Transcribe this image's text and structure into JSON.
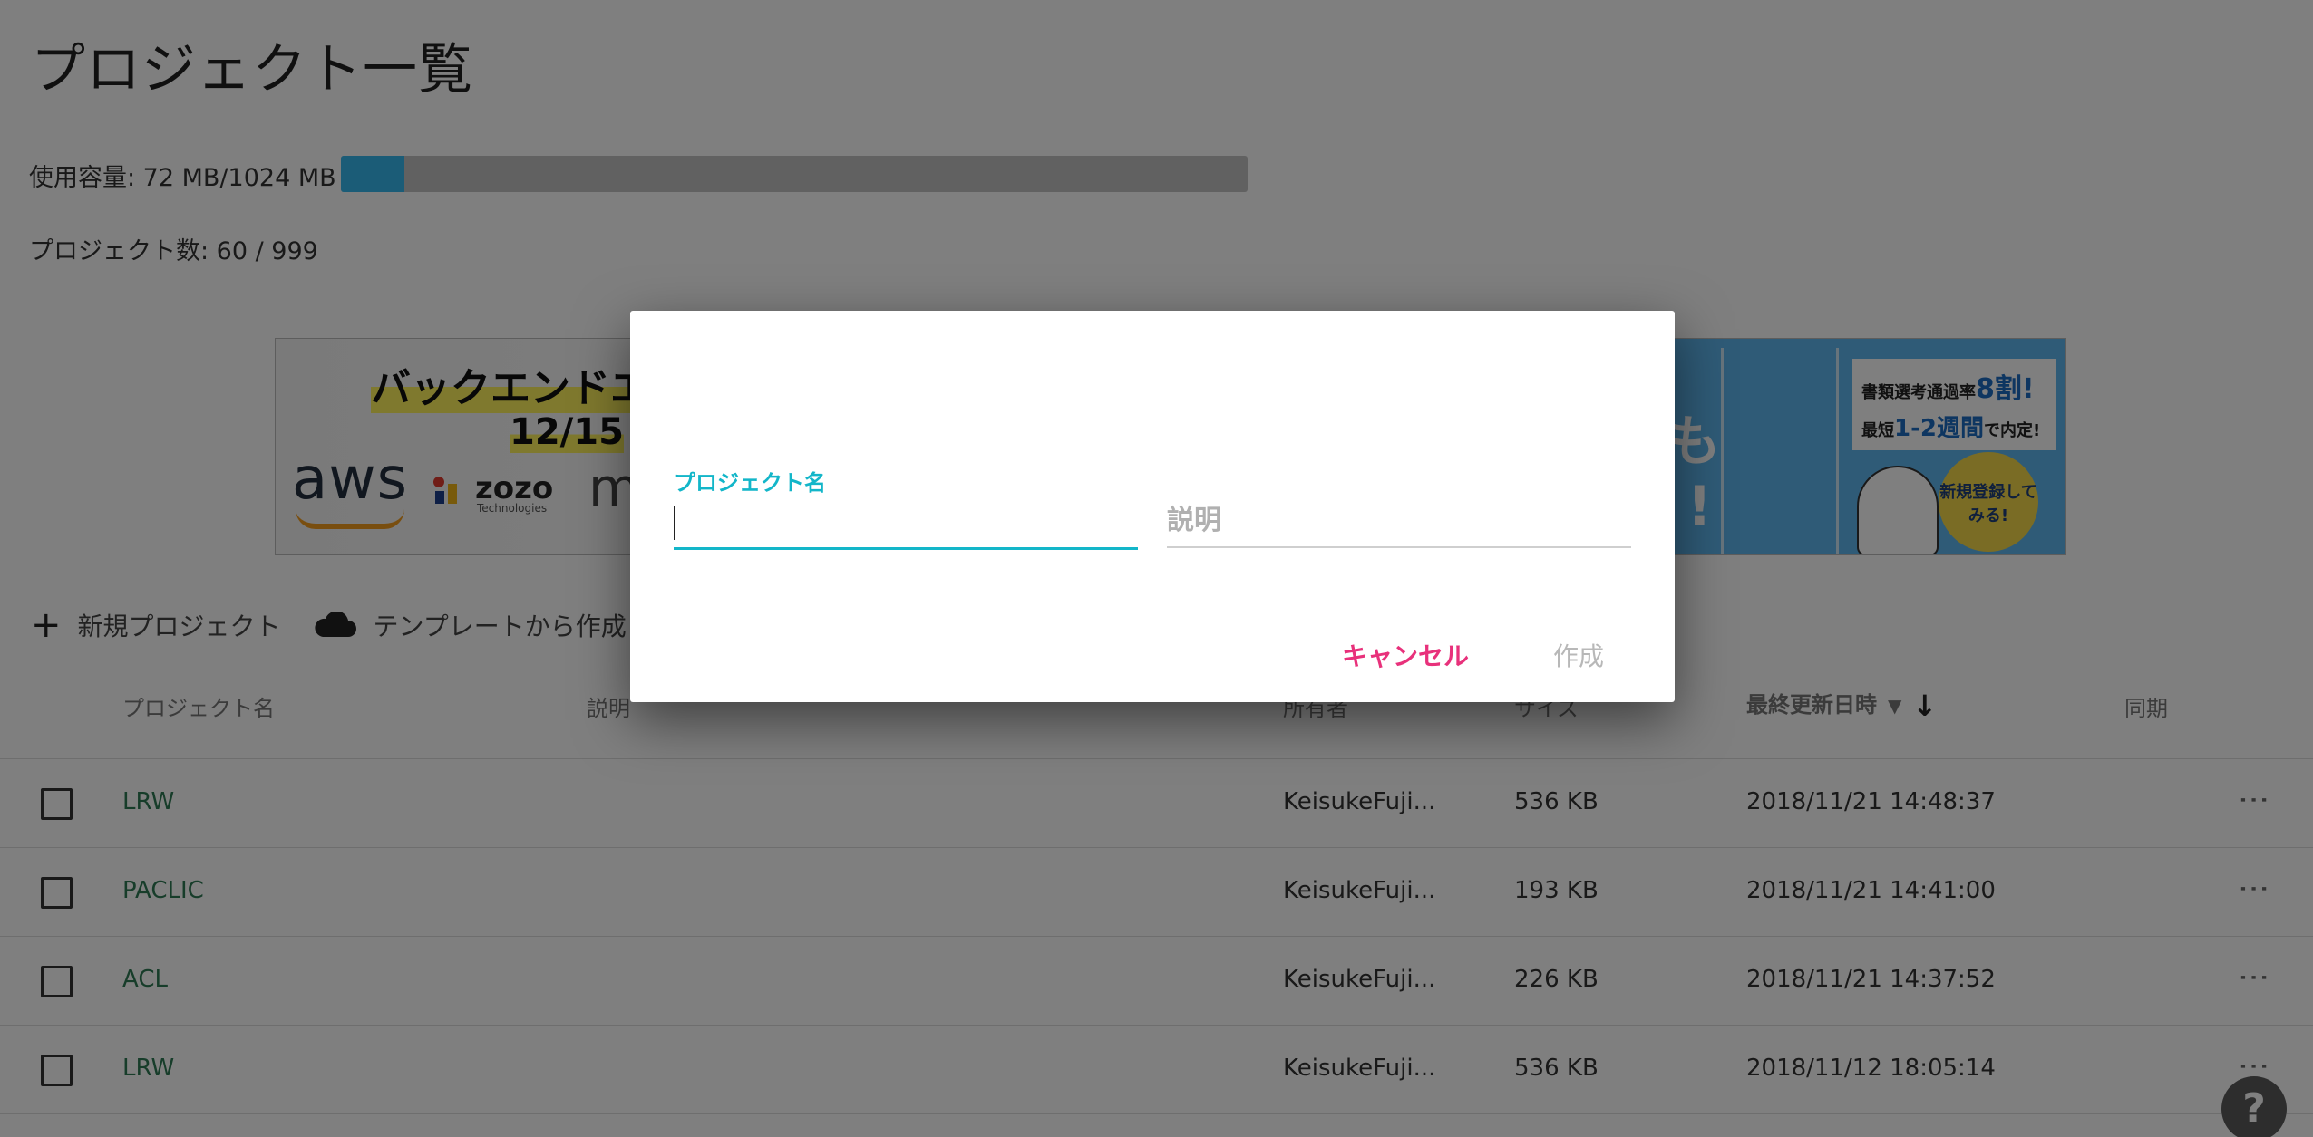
{
  "page": {
    "title": "プロジェクト一覧",
    "usage_label": "使用容量: 72 MB/1024 MB",
    "usage_fraction": 0.0703,
    "project_count_label": "プロジェクト数: 60 / 999"
  },
  "banner": {
    "headline": "バックエンドエ",
    "date": "12/15",
    "logos": [
      "aws",
      "zozo",
      "m"
    ],
    "zozo_sub": "Technologies",
    "right_line1_prefix": "書類選考通過率",
    "right_line1_highlight": "8割!",
    "right_line2_prefix": "最短",
    "right_line2_highlight": "1-2週間",
    "right_line2_suffix": "で内定!",
    "badge": "新規登録してみる!",
    "big_text1": "も",
    "big_text2": "!"
  },
  "toolbar": {
    "new_project_label": "新規プロジェクト",
    "from_template_label": "テンプレートから作成"
  },
  "table": {
    "headers": {
      "name": "プロジェクト名",
      "description": "説明",
      "owner": "所有者",
      "size": "サイズ",
      "updated": "最終更新日時",
      "sync": "同期"
    },
    "rows": [
      {
        "name": "LRW",
        "owner": "KeisukeFuji...",
        "size": "536 KB",
        "updated": "2018/11/21 14:48:37"
      },
      {
        "name": "PACLIC",
        "owner": "KeisukeFuji...",
        "size": "193 KB",
        "updated": "2018/11/21 14:41:00"
      },
      {
        "name": "ACL",
        "owner": "KeisukeFuji...",
        "size": "226 KB",
        "updated": "2018/11/21 14:37:52"
      },
      {
        "name": "LRW",
        "owner": "KeisukeFuji...",
        "size": "536 KB",
        "updated": "2018/11/12 18:05:14"
      }
    ]
  },
  "help_label": "?",
  "dialog": {
    "name_label": "プロジェクト名",
    "name_value": "",
    "description_placeholder": "説明",
    "cancel_label": "キャンセル",
    "create_label": "作成"
  },
  "colors": {
    "accent": "#13b6c9",
    "cancel": "#e8317b",
    "link_green": "#2f7a55",
    "usage_bar": "#36b8ee"
  }
}
